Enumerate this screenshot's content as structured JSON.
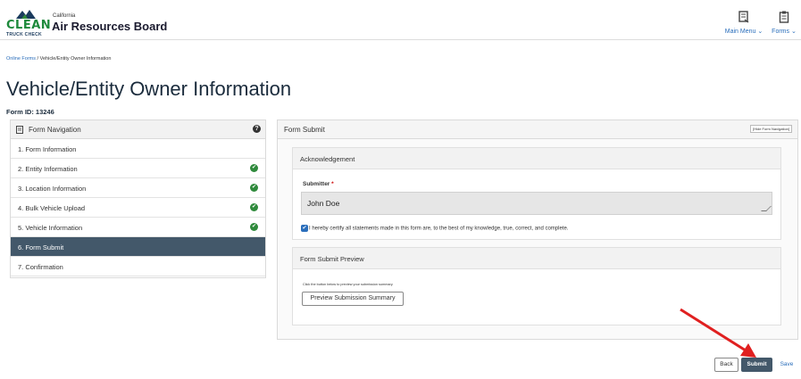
{
  "header": {
    "logo_text": "CLEAN",
    "logo_subtext": "TRUCK CHECK",
    "org_small": "California",
    "org_name": "Air Resources Board",
    "main_menu_label": "Main Menu ⌄",
    "forms_label": "Forms ⌄"
  },
  "breadcrumb": {
    "link": "Online Forms",
    "separator": "/",
    "current": "Vehicle/Entity Owner Information"
  },
  "page": {
    "title": "Vehicle/Entity Owner Information",
    "form_id": "Form ID: 13246"
  },
  "nav": {
    "title": "Form Navigation",
    "help_icon": "?",
    "items": [
      {
        "label": "1. Form Information",
        "complete": false
      },
      {
        "label": "2. Entity Information",
        "complete": true
      },
      {
        "label": "3. Location Information",
        "complete": true
      },
      {
        "label": "4. Bulk Vehicle Upload",
        "complete": true
      },
      {
        "label": "5. Vehicle Information",
        "complete": true
      },
      {
        "label": "6. Form Submit",
        "complete": false,
        "active": true
      },
      {
        "label": "7. Confirmation",
        "complete": false
      }
    ],
    "check_glyph": "✔"
  },
  "main": {
    "title": "Form Submit",
    "hide_button": "[Hide Form Navigation]"
  },
  "acknowledgement": {
    "title": "Acknowledgement",
    "submitter_label": "Submitter",
    "required_mark": "*",
    "submitter_value": "John Doe",
    "certify_text": "I hereby certify all statements made in this form are, to the best of my knowledge, true, correct, and complete.",
    "checkbox_glyph": "✔"
  },
  "preview": {
    "title": "Form Submit Preview",
    "note": "Click the button below to preview your submission summary.",
    "button": "Preview Submission Summary"
  },
  "actions": {
    "back": "Back",
    "submit": "Submit",
    "save": "Save"
  },
  "colors": {
    "brand_green": "#1e8a3c",
    "primary_dark": "#43586a",
    "link_blue": "#2a6ebb",
    "annotation_arrow": "#e02020"
  }
}
